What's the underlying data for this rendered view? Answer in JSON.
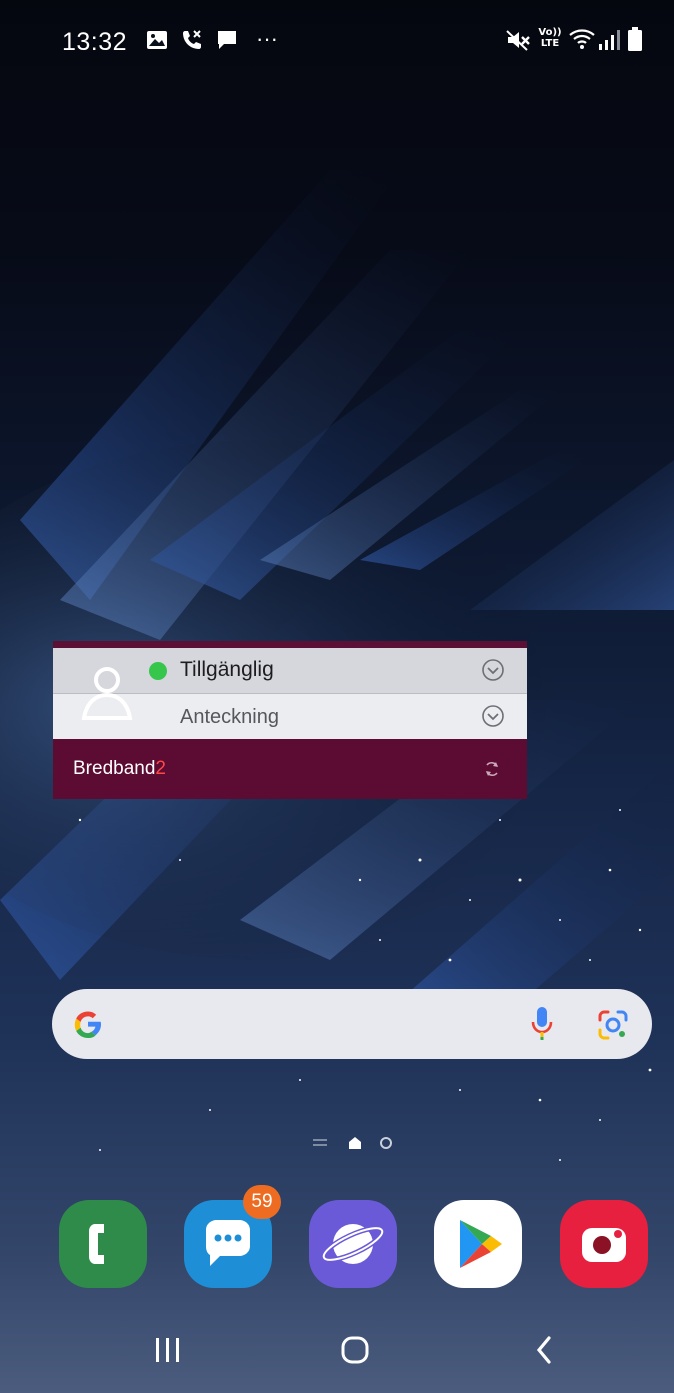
{
  "status_bar": {
    "time": "13:32",
    "left_icons": [
      "gallery-icon",
      "missed-call-icon",
      "message-icon",
      "more-notifications-icon"
    ],
    "right_icons": [
      "mute-icon",
      "volte-icon",
      "wifi-icon",
      "signal-icon",
      "battery-icon"
    ],
    "volte_line1": "Vo))",
    "volte_line2": "LTE",
    "more_dots": "···"
  },
  "widget": {
    "status_label": "Tillgänglig",
    "status_color": "#35c64b",
    "note_label": "Anteckning",
    "brand_main": "Bredband",
    "brand_accent": "2",
    "brand_color": "#5c0b33"
  },
  "search_bar": {
    "icons": [
      "google-logo-icon",
      "microphone-icon",
      "google-lens-icon"
    ]
  },
  "page_indicator": {
    "icons": [
      "menu-page-icon",
      "home-page-icon",
      "page-dot-icon"
    ],
    "active": "home"
  },
  "dock": {
    "apps": [
      {
        "name": "Phone",
        "icon": "phone-icon",
        "color": "#2e8b4a"
      },
      {
        "name": "Messages",
        "icon": "messages-icon",
        "color": "#1e8fd6",
        "badge": "59"
      },
      {
        "name": "Internet",
        "icon": "internet-icon",
        "color": "#6b5ad8"
      },
      {
        "name": "Play Store",
        "icon": "play-store-icon",
        "color": "#ffffff"
      },
      {
        "name": "Camera",
        "icon": "camera-icon",
        "color": "#e8203f"
      }
    ]
  },
  "nav_bar": {
    "buttons": [
      "recents-icon",
      "home-icon",
      "back-icon"
    ]
  }
}
